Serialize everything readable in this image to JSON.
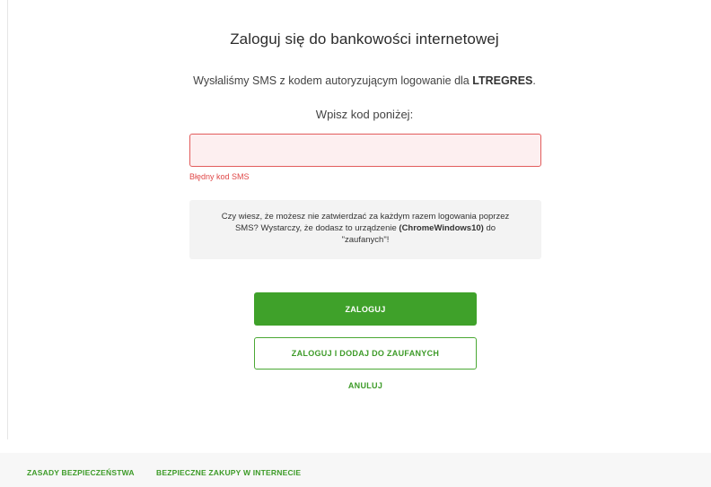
{
  "login": {
    "title": "Zaloguj się do bankowości internetowej",
    "sms_info_prefix": "Wysłaliśmy SMS z kodem autoryzującym logowanie dla ",
    "username": "LTREGRES",
    "sms_info_suffix": ".",
    "prompt": "Wpisz kod poniżej:",
    "code_input_value": "",
    "error_message": "Błędny kod SMS"
  },
  "trusted_info": {
    "text_prefix": "Czy wiesz, że możesz nie zatwierdzać za każdym razem logowania poprzez SMS? Wystarczy, że dodasz to urządzenie ",
    "device_name": "(ChromeWindows10)",
    "text_suffix": " do \"zaufanych\"!"
  },
  "actions": {
    "login_label": "ZALOGUJ",
    "login_trusted_label": "ZALOGUJ I DODAJ DO ZAUFANYCH",
    "cancel_label": "ANULUJ"
  },
  "footer": {
    "links": [
      {
        "label": "ZASADY BEZPIECZEŃSTWA"
      },
      {
        "label": "BEZPIECZNE ZAKUPY W INTERNECIE"
      }
    ]
  },
  "colors": {
    "accent_green": "#3fa12a",
    "error_red": "#e04848",
    "error_input_bg": "#fdeff0",
    "info_box_bg": "#f3f3f3"
  }
}
